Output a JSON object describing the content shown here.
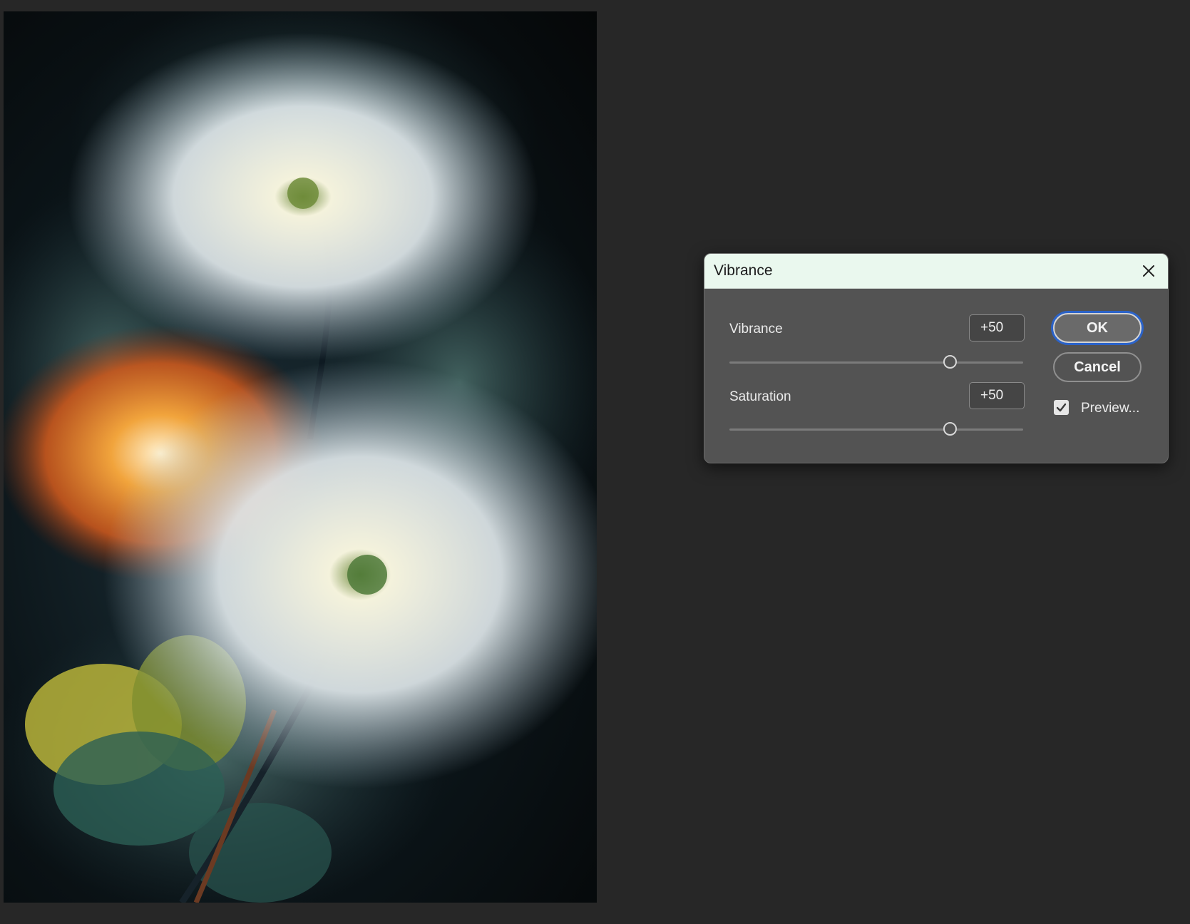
{
  "dialog": {
    "title": "Vibrance",
    "vibrance": {
      "label": "Vibrance",
      "value": "+50",
      "slider_fraction": 0.75
    },
    "saturation": {
      "label": "Saturation",
      "value": "+50",
      "slider_fraction": 0.75
    },
    "ok_label": "OK",
    "cancel_label": "Cancel",
    "preview": {
      "label": "Preview...",
      "checked": true
    }
  },
  "icons": {
    "close": "close-icon",
    "check": "checkmark-icon"
  },
  "colors": {
    "titlebar": "#eaf8ee",
    "dialog_bg": "#535353",
    "workspace_bg": "#272727",
    "focus_ring": "#2b63c9"
  }
}
